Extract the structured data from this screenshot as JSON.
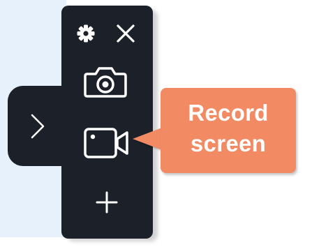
{
  "callout": {
    "text": "Record\nscreen"
  },
  "toolbar": {
    "buttons": [
      {
        "name": "settings",
        "icon": "gear-icon"
      },
      {
        "name": "close",
        "icon": "close-icon"
      },
      {
        "name": "screenshot",
        "icon": "camera-icon"
      },
      {
        "name": "record-screen",
        "icon": "video-camera-icon"
      },
      {
        "name": "add",
        "icon": "plus-icon"
      },
      {
        "name": "expand",
        "icon": "chevron-right-icon"
      }
    ]
  },
  "colors": {
    "toolbar_bg": "#1b2029",
    "callout_bg": "#f28a63",
    "icon_color": "#ffffff",
    "side_panel": "#e7f1fb"
  }
}
